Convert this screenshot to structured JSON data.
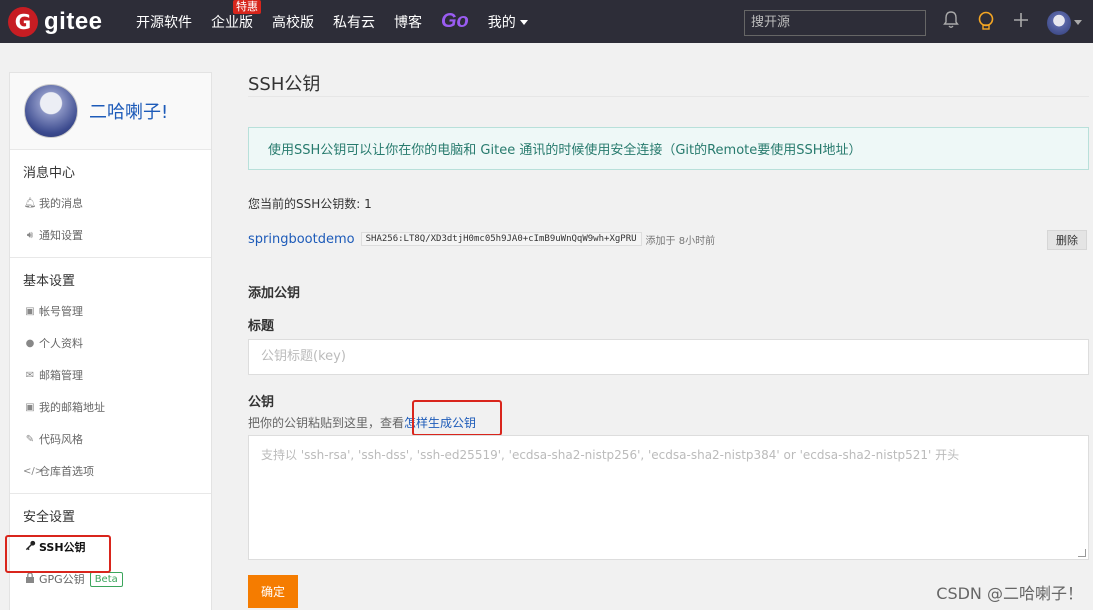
{
  "nav": {
    "logo_letter": "G",
    "logo_text": "gitee",
    "links": {
      "open_source": "开源软件",
      "enterprise": "企业版",
      "enterprise_badge": "特惠",
      "university": "高校版",
      "private_cloud": "私有云",
      "blog": "博客",
      "go": "Go",
      "mine": "我的"
    },
    "search_placeholder": "搜开源"
  },
  "sidebar": {
    "user_name": "二哈喇子!",
    "sections": {
      "messages": {
        "title": "消息中心",
        "items": [
          "我的消息",
          "通知设置"
        ]
      },
      "basic": {
        "title": "基本设置",
        "items": [
          "帐号管理",
          "个人资料",
          "邮箱管理",
          "我的邮箱地址",
          "代码风格",
          "仓库首选项"
        ]
      },
      "security": {
        "title": "安全设置",
        "items": [
          "SSH公钥",
          "GPG公钥"
        ],
        "beta_badge": "Beta"
      }
    }
  },
  "main": {
    "title": "SSH公钥",
    "info": "使用SSH公钥可以让你在你的电脑和 Gitee 通讯的时候使用安全连接（Git的Remote要使用SSH地址）",
    "key_count": "您当前的SSH公钥数: 1",
    "key": {
      "name": "springbootdemo",
      "fingerprint": "SHA256:LT8Q/XD3dtjH0mc05h9JA0+cImB9uWnQqW9wh+XgPRU",
      "added": "添加于 8小时前",
      "delete_label": "删除"
    },
    "add_title": "添加公钥",
    "title_label": "标题",
    "title_placeholder": "公钥标题(key)",
    "key_label": "公钥",
    "key_hint": "把你的公钥粘贴到这里，查看",
    "key_hint_link": "怎样生成公钥",
    "key_placeholder": "支持以 'ssh-rsa', 'ssh-dss', 'ssh-ed25519', 'ecdsa-sha2-nistp256', 'ecdsa-sha2-nistp384' or 'ecdsa-sha2-nistp521' 开头",
    "submit_label": "确定"
  },
  "watermark": "CSDN @二哈喇子！",
  "colors": {
    "nav_bg": "#2d2d38",
    "brand_red": "#c71d23",
    "link_blue": "#1d5bb9",
    "submit_orange": "#f57c00",
    "highlight_red": "#d9251c"
  }
}
